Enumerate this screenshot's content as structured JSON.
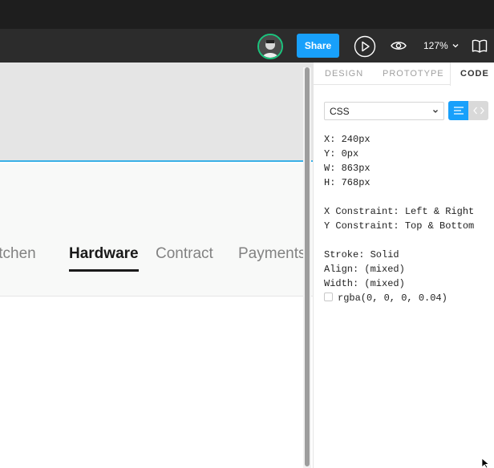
{
  "toolbar": {
    "avatar": "avatar",
    "share_label": "Share",
    "play_icon": "play-icon",
    "eye_icon": "eye-icon",
    "zoom_level": "127%",
    "book_icon": "book-icon"
  },
  "canvas": {
    "nav_items": [
      {
        "label": "itchen"
      },
      {
        "label": "Hardware"
      },
      {
        "label": "Contract"
      },
      {
        "label": "Payments"
      }
    ],
    "active_nav": "Hardware",
    "frame_border_color": "#39b0e6"
  },
  "panel": {
    "tabs": [
      {
        "label": "DESIGN"
      },
      {
        "label": "PROTOTYPE"
      },
      {
        "label": "CODE"
      }
    ],
    "active_tab": "CODE",
    "language_select": "CSS",
    "code_lines": [
      "X: 240px",
      "Y: 0px",
      "W: 863px",
      "H: 768px",
      "",
      "X Constraint: Left & Right",
      "Y Constraint: Top & Bottom",
      "",
      "Stroke: Solid",
      "Align: (mixed)",
      "Width: (mixed)",
      "rgba(0, 0, 0, 0.04)"
    ]
  },
  "colors": {
    "accent": "#18a0fb",
    "avatar_ring": "#1bc47d",
    "toolbar_bg": "#2c2c2c",
    "titlebar_bg": "#1e1e1e"
  }
}
